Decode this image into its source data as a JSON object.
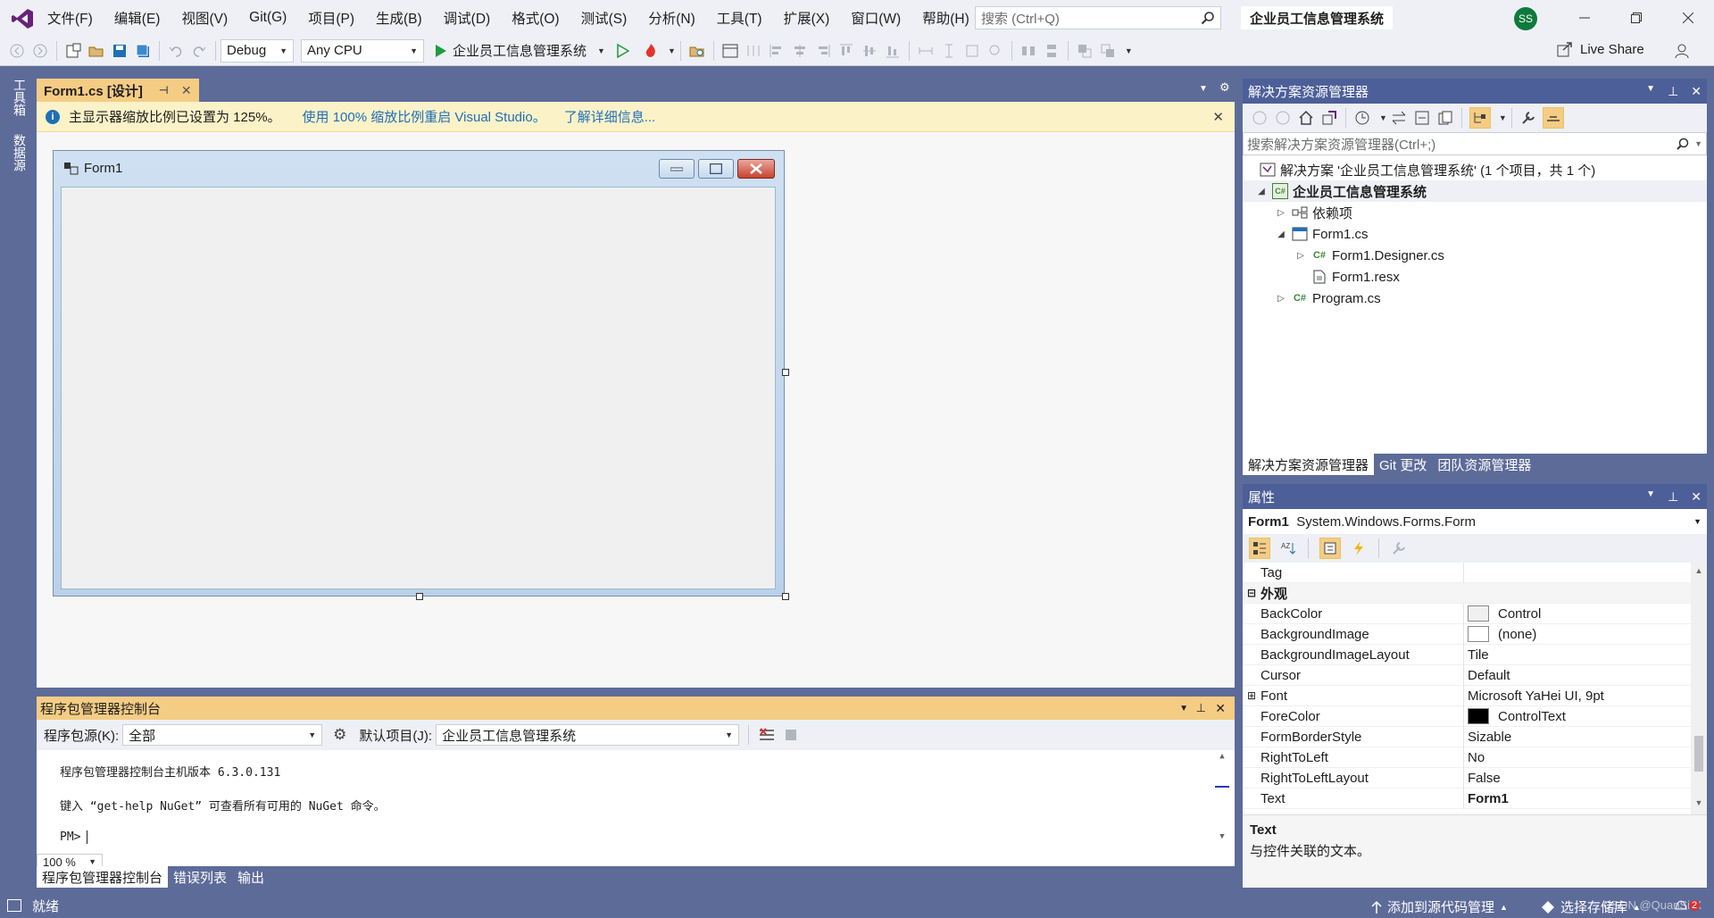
{
  "menu": {
    "items": [
      "文件(F)",
      "编辑(E)",
      "视图(V)",
      "Git(G)",
      "项目(P)",
      "生成(B)",
      "调试(D)",
      "格式(O)",
      "测试(S)",
      "分析(N)",
      "工具(T)",
      "扩展(X)",
      "窗口(W)",
      "帮助(H)"
    ],
    "search_placeholder": "搜索 (Ctrl+Q)",
    "project_title": "企业员工信息管理系统",
    "avatar_initials": "SS"
  },
  "toolbar": {
    "config": "Debug",
    "platform": "Any CPU",
    "start_target": "企业员工信息管理系统",
    "live_share": "Live Share"
  },
  "left_rail": {
    "toolbox": "工具箱",
    "datasource": "数据源"
  },
  "doc": {
    "tab_label": "Form1.cs [设计]",
    "info_text": "主显示器缩放比例已设置为 125%。",
    "info_link1": "使用 100% 缩放比例重启 Visual Studio。",
    "info_link2": "了解详细信息...",
    "form_title": "Form1"
  },
  "pmc": {
    "title": "程序包管理器控制台",
    "source_label": "程序包源(K):",
    "source_value": "全部",
    "default_project_label": "默认项目(J):",
    "default_project_value": "企业员工信息管理系统",
    "line1": "程序包管理器控制台主机版本 6.3.0.131",
    "line2": "键入 “get-help NuGet” 可查看所有可用的 NuGet 命令。",
    "prompt": "PM>",
    "zoom": "100 %",
    "tabs": [
      "程序包管理器控制台",
      "错误列表",
      "输出"
    ]
  },
  "solution": {
    "title": "解决方案资源管理器",
    "search_placeholder": "搜索解决方案资源管理器(Ctrl+;)",
    "root": "解决方案 '企业员工信息管理系统' (1 个项目，共 1 个)",
    "project": "企业员工信息管理系统",
    "deps": "依赖项",
    "form1": "Form1.cs",
    "designer": "Form1.Designer.cs",
    "resx": "Form1.resx",
    "program": "Program.cs",
    "tabs": [
      "解决方案资源管理器",
      "Git 更改",
      "团队资源管理器"
    ]
  },
  "properties": {
    "title": "属性",
    "object_name": "Form1",
    "object_type": "System.Windows.Forms.Form",
    "rows_top": {
      "tag": "Tag"
    },
    "category": "外观",
    "rows": [
      {
        "name": "BackColor",
        "value": "Control",
        "swatch": "#f0f0f0"
      },
      {
        "name": "BackgroundImage",
        "value": "(none)",
        "swatch": "#ffffff"
      },
      {
        "name": "BackgroundImageLayout",
        "value": "Tile"
      },
      {
        "name": "Cursor",
        "value": "Default"
      },
      {
        "name": "Font",
        "value": "Microsoft YaHei UI, 9pt"
      },
      {
        "name": "ForeColor",
        "value": "ControlText",
        "swatch": "#000000"
      },
      {
        "name": "FormBorderStyle",
        "value": "Sizable"
      },
      {
        "name": "RightToLeft",
        "value": "No"
      },
      {
        "name": "RightToLeftLayout",
        "value": "False"
      },
      {
        "name": "Text",
        "value": "Form1"
      }
    ],
    "desc_title": "Text",
    "desc_text": "与控件关联的文本。"
  },
  "status": {
    "ready": "就绪",
    "add_source": "添加到源代码管理",
    "select_repo": "选择存储库",
    "watermark": "CSDN @QuanSirX",
    "notif_count": "2"
  },
  "colors": {
    "accent": "#5d6b99",
    "tab_active": "#f5cc84",
    "vs_purple": "#68217a"
  }
}
